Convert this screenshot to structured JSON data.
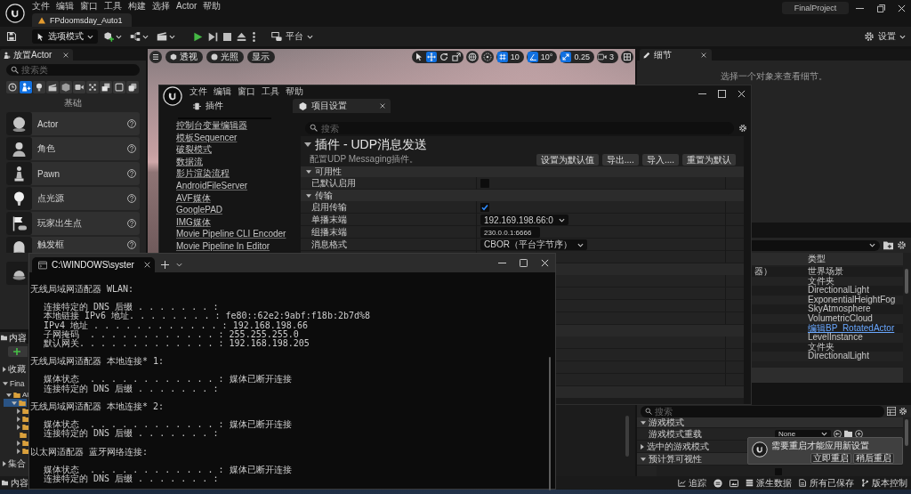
{
  "editor": {
    "menu": [
      "文件",
      "编辑",
      "窗口",
      "工具",
      "构建",
      "选择",
      "Actor",
      "帮助"
    ],
    "level_tab": "FPdoomsday_Auto1",
    "project": "FinalProject",
    "toolbar": {
      "mode": "选项模式",
      "platform": "平台",
      "settings": "设置"
    },
    "place_actors": {
      "tab": "放置Actor",
      "search_placeholder": "搜索类",
      "categories": [
        {
          "selected": false
        },
        {
          "selected": true
        },
        {
          "selected": false
        },
        {
          "selected": false
        },
        {
          "selected": false
        },
        {
          "selected": false
        },
        {
          "selected": false
        },
        {
          "selected": false
        },
        {
          "selected": false
        },
        {
          "selected": false
        }
      ],
      "group_title": "基础",
      "items": [
        {
          "label": "Actor",
          "covered": false
        },
        {
          "label": "角色",
          "covered": false
        },
        {
          "label": "Pawn",
          "covered": false
        },
        {
          "label": "点光源",
          "covered": false
        },
        {
          "label": "玩家出生点",
          "covered": false
        },
        {
          "label": "触发框",
          "covered": false
        },
        {
          "covered": true
        }
      ]
    },
    "content_browser": {
      "tab": "内容",
      "favorites": "收藏",
      "project": "Fina",
      "tree": [
        {
          "label": "Al",
          "selected": false,
          "expanded": true,
          "children": [
            {
              "selected": true,
              "expanded": true,
              "children": [
                {
                  "selected": false,
                  "expandable": true
                },
                {
                  "selected": false,
                  "expandable": true
                },
                {
                  "selected": false,
                  "expandable": true
                },
                {
                  "selected": false,
                  "expandable": false
                },
                {
                  "selected": false,
                  "expandable": true
                },
                {
                  "selected": false,
                  "expandable": true
                }
              ]
            }
          ]
        }
      ],
      "collections": "集合"
    },
    "viewport": {
      "view_buttons": [
        "透视",
        "光照",
        "显示"
      ],
      "tools": [
        {
          "selected": false
        },
        {
          "selected": true
        },
        {
          "selected": false
        },
        {
          "selected": false
        }
      ],
      "snaps": [
        {
          "value": "10",
          "on": true
        },
        {
          "value": "10°",
          "on": true
        },
        {
          "value": "0.25",
          "on": true
        }
      ],
      "camera_speed": "3"
    },
    "details": {
      "tab": "细节",
      "empty_message": "选择一个对象来查看细节。"
    },
    "outliner": {
      "type_header": "类型",
      "rows": [
        {
          "name": "器）",
          "type": "世界场景",
          "kind": "text"
        },
        {
          "type": "文件夹",
          "kind": "text"
        },
        {
          "type": "DirectionalLight",
          "kind": "text"
        },
        {
          "type": "ExponentialHeightFog",
          "kind": "text"
        },
        {
          "type": "SkyAtmosphere",
          "kind": "text"
        },
        {
          "type": "VolumetricCloud",
          "kind": "text"
        },
        {
          "type": "编辑BP_RotatedActor",
          "kind": "link"
        },
        {
          "type": "LevelInstance",
          "kind": "text"
        },
        {
          "type": "文件夹",
          "kind": "text"
        },
        {
          "type": "DirectionalLight",
          "kind": "text"
        }
      ]
    },
    "world_settings": {
      "search_placeholder": "搜索",
      "rows": [
        {
          "kind": "section",
          "label": "游戏模式",
          "expanded": true
        },
        {
          "kind": "property",
          "label": "游戏模式重载",
          "value": "None"
        },
        {
          "kind": "group",
          "label": "选中的游戏模式",
          "expanded": false
        },
        {
          "kind": "section",
          "label": "预计算可视性",
          "expanded": true
        },
        {
          "kind": "checkbox",
          "checked": false
        }
      ]
    },
    "notification": {
      "message": "需要重启才能应用新设置",
      "buttons": [
        "立即重启",
        "稍后重启"
      ]
    },
    "status_bar": {
      "drawer": "内容",
      "items": [
        "追踪",
        "派生数据",
        "所有已保存",
        "版本控制"
      ]
    }
  },
  "plugin_window": {
    "menu": [
      "文件",
      "编辑",
      "窗口",
      "工具",
      "帮助"
    ],
    "tabs": [
      {
        "label": "插件",
        "selected": false
      },
      {
        "label": "项目设置",
        "selected": true
      }
    ],
    "categories": [
      "控制台变量编辑器",
      "模板Sequencer",
      "破裂模式",
      "数据流",
      "影片渲染流程",
      "AndroidFileServer",
      "AVF媒体",
      "GooglePAD",
      "IMG媒体",
      "Movie Pipeline CLI Encoder",
      "Movie Pipeline In Editor"
    ],
    "search_placeholder": "搜索",
    "title": "插件 - UDP消息发送",
    "expanded": true,
    "description": "配置UDP Messaging插件。",
    "actions": [
      "设置为默认值",
      "导出....",
      "导入....",
      "重置为默认"
    ],
    "sections": [
      {
        "title": "可用性",
        "expanded": true,
        "rows": [
          {
            "kind": "checkbox",
            "label": "已默认启用",
            "checked": false
          }
        ]
      },
      {
        "title": "传输",
        "expanded": true,
        "rows": [
          {
            "kind": "checkbox",
            "label": "启用传输",
            "checked": true
          },
          {
            "kind": "dropdown",
            "label": "单播末端",
            "value": "192.169.198.66:0"
          },
          {
            "kind": "text",
            "label": "组播末端",
            "value": "230.0.0.1:6666"
          },
          {
            "kind": "dropdown",
            "label": "消息格式",
            "value": "CBOR（平台字节序）"
          }
        ]
      }
    ]
  },
  "terminal": {
    "tab_title": "C:\\WINDOWS\\syster",
    "blocks": [
      {
        "heading": "无线局域网适配器 WLAN:",
        "entries": [
          "连接特定的 DNS 后缀 . . . . . . . :",
          "本地链接 IPv6 地址. . . . . . . . : fe80::62e2:9abf:f18b:2b7d%8",
          "IPv4 地址 . . . . . . . . . . . . : 192.168.198.66",
          "子网掩码  . . . . . . . . . . . . : 255.255.255.0",
          "默认网关. . . . . . . . . . . . . : 192.168.198.205"
        ]
      },
      {
        "heading": "无线局域网适配器 本地连接* 1:",
        "entries": [
          "媒体状态  . . . . . . . . . . . . : 媒体已断开连接",
          "连接特定的 DNS 后缀 . . . . . . . :"
        ]
      },
      {
        "heading": "无线局域网适配器 本地连接* 2:",
        "entries": [
          "媒体状态  . . . . . . . . . . . . : 媒体已断开连接",
          "连接特定的 DNS 后缀 . . . . . . . :"
        ]
      },
      {
        "heading": "以太网适配器 蓝牙网络连接:",
        "entries": [
          "媒体状态  . . . . . . . . . . . . : 媒体已断开连接",
          "连接特定的 DNS 后缀 . . . . . . . :"
        ]
      }
    ]
  }
}
